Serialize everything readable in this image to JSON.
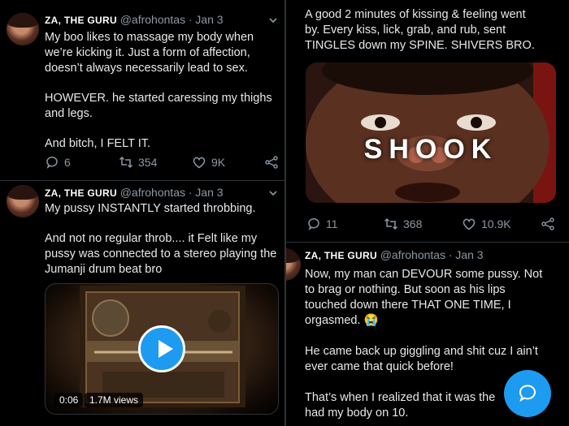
{
  "left": {
    "tweet1": {
      "name": "ZA, THE GURU",
      "handle": "@afrohontas",
      "dot": "·",
      "date": "Jan 3",
      "lines": [
        "My boo likes to massage my body when",
        "we’re kicking it. Just a form of affection,",
        "doesn’t always necessarily lead to sex.",
        "",
        "HOWEVER. he started caressing my thighs",
        "and legs.",
        "",
        "And bitch, I FELT IT."
      ],
      "replies": "6",
      "retweets": "354",
      "likes": "9K"
    },
    "tweet2": {
      "name": "ZA, THE GURU",
      "handle": "@afrohontas",
      "dot": "·",
      "date": "Jan 3",
      "lines": [
        "My pussy INSTANTLY started throbbing.",
        "",
        "And not no regular throb.... it Felt like my",
        "pussy was connected to a stereo playing the",
        "Jumanji drum beat bro"
      ],
      "video_time": "0:06",
      "video_views": "1.7M views"
    }
  },
  "right": {
    "tweet_top": {
      "lines": [
        "A good 2 minutes of kissing & feeling went",
        "by. Every kiss, lick, grab, and rub, sent",
        "TINGLES down my SPINE. SHIVERS BRO."
      ],
      "image_caption": "SHOOK",
      "replies": "11",
      "retweets": "368",
      "likes": "10.9K"
    },
    "tweet3": {
      "name": "ZA, THE GURU",
      "handle": "@afrohontas",
      "dot": "·",
      "date": "Jan 3",
      "lines": [
        "Now, my man can DEVOUR some pussy. Not",
        "to brag or nothing. But soon as his lips",
        "touched down there THAT ONE TIME, I",
        "orgasmed. 😭",
        "",
        "He came back up giggling and shit cuz I ain’t",
        "ever came that quick before!",
        "",
        "That’s when I realized that it was the",
        "had my body on 10."
      ]
    }
  },
  "colors": {
    "accent": "#1d9bf0",
    "muted": "#8b98a5",
    "text": "#e7e9ea",
    "background": "#000000"
  }
}
